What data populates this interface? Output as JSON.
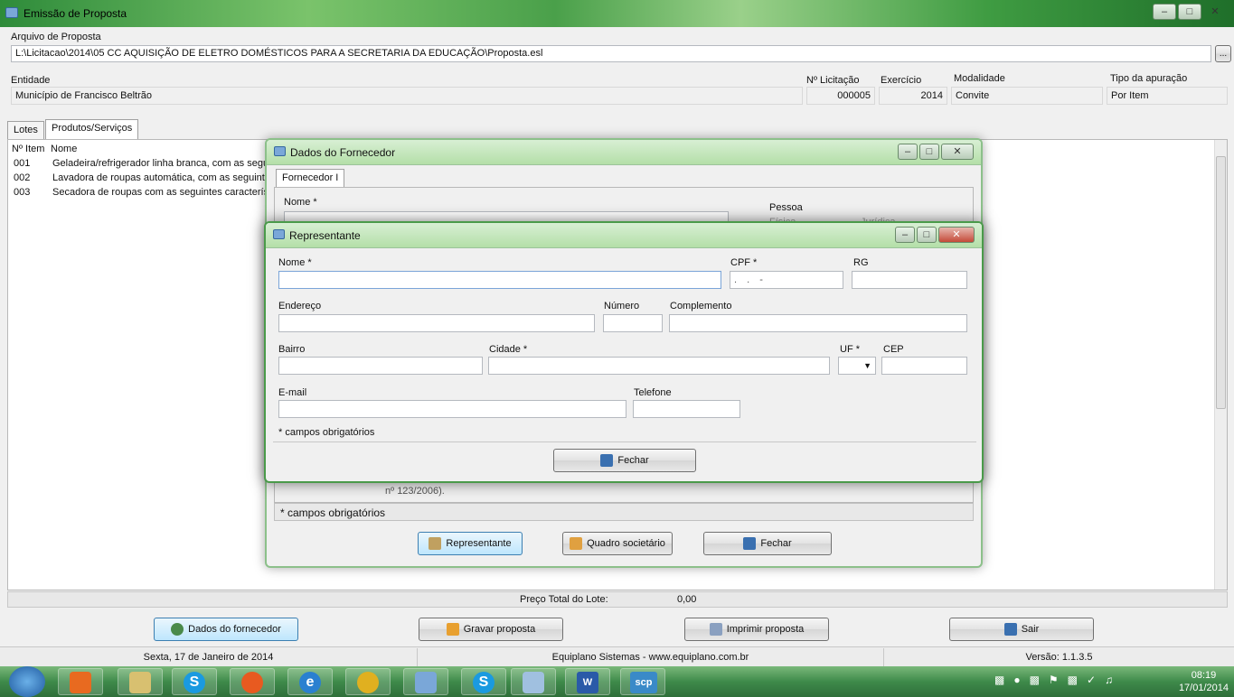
{
  "window": {
    "title": "Emissão de Proposta"
  },
  "arquivo": {
    "label": "Arquivo de Proposta",
    "value": "L:\\Licitacao\\2014\\05 CC AQUISIÇÃO DE ELETRO DOMÉSTICOS PARA A SECRETARIA DA EDUCAÇÃO\\Proposta.esl",
    "browse_label": "..."
  },
  "header": {
    "entidade_label": "Entidade",
    "entidade_value": "Município de Francisco Beltrão",
    "licitacao_label": "Nº Licitação",
    "licitacao_value": "000005",
    "exercicio_label": "Exercício",
    "exercicio_value": "2014",
    "modalidade_label": "Modalidade",
    "modalidade_value": "Convite",
    "apuracao_label": "Tipo da apuração",
    "apuracao_value": "Por Item"
  },
  "tabs": [
    {
      "label": "Lotes"
    },
    {
      "label": "Produtos/Serviços"
    }
  ],
  "list": {
    "headers": {
      "item": "Nº Item",
      "nome": "Nome"
    },
    "rows": [
      {
        "item": "001",
        "nome": "Geladeira/refrigerador linha branca, com as seguin"
      },
      {
        "item": "002",
        "nome": "Lavadora de roupas automática, com as seguintes"
      },
      {
        "item": "003",
        "nome": "Secadora de roupas com as seguintes característi"
      }
    ]
  },
  "total": {
    "label": "Preço Total do Lote:",
    "value": "0,00"
  },
  "bottom_buttons": {
    "fornecedor": "Dados do fornecedor",
    "gravar": "Gravar proposta",
    "imprimir": "Imprimir proposta",
    "sair": "Sair"
  },
  "status": {
    "date": "Sexta, 17 de Janeiro de 2014",
    "company": "Equiplano Sistemas - www.equiplano.com.br",
    "version": "Versão: 1.1.3.5"
  },
  "fornecedor_dialog": {
    "title": "Dados do Fornecedor",
    "tab": "Fornecedor I",
    "nome_label": "Nome *",
    "pessoa_label": "Pessoa",
    "fisica": "Física",
    "juridica": "Jurídica",
    "obrig_fragment": "nº 123/2006).",
    "obrig": "* campos obrigatórios",
    "btn_representante": "Representante",
    "btn_quadro": "Quadro societário",
    "btn_fechar": "Fechar"
  },
  "representante_dialog": {
    "title": "Representante",
    "nome_label": "Nome *",
    "cpf_label": "CPF *",
    "cpf_mask": ". . -",
    "rg_label": "RG",
    "endereco_label": "Endereço",
    "numero_label": "Número",
    "complemento_label": "Complemento",
    "bairro_label": "Bairro",
    "cidade_label": "Cidade *",
    "uf_label": "UF *",
    "cep_label": "CEP",
    "email_label": "E-mail",
    "telefone_label": "Telefone",
    "obrig": "* campos obrigatórios",
    "btn_fechar": "Fechar"
  },
  "taskbar": {
    "time": "08:19",
    "date": "17/01/2014",
    "scp_label": "scp"
  }
}
